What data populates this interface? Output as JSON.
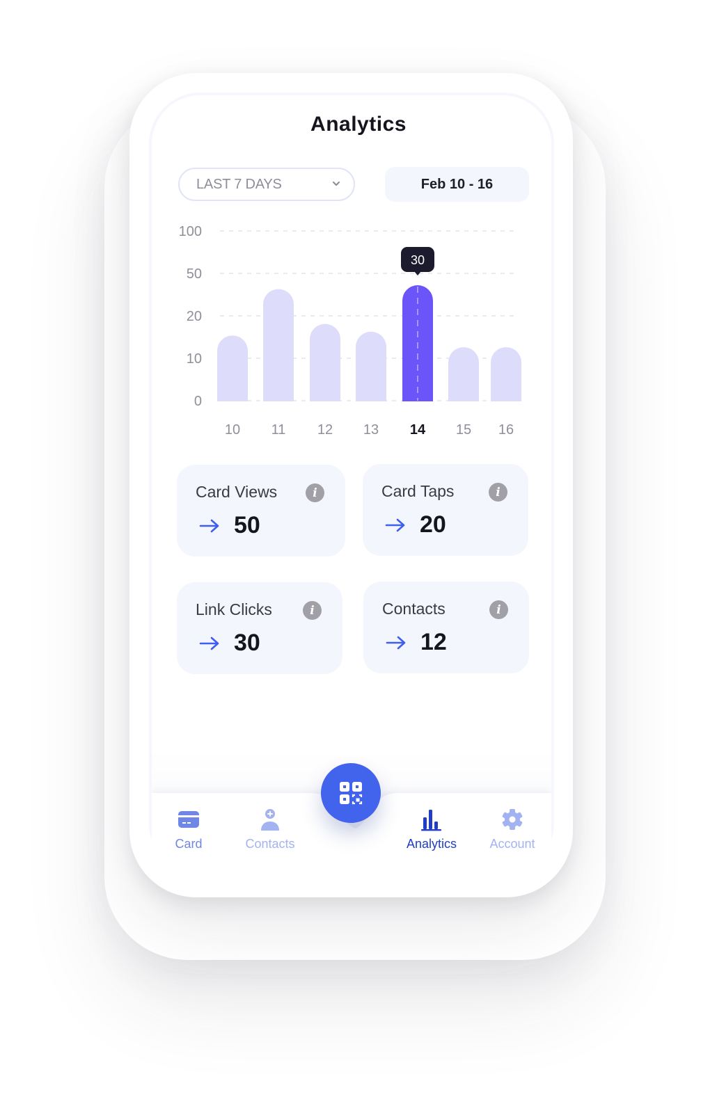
{
  "header": {
    "title": "Analytics"
  },
  "filters": {
    "range_selected": "LAST 7 DAYS",
    "date_range": "Feb 10 - 16"
  },
  "colors": {
    "bar": "#dedcfb",
    "bar_active": "#6c55f8",
    "accent": "#4263eb",
    "nav_active": "#1f3dc7",
    "nav_inactive": "#9fb0ef",
    "nav_card": "#6f86e6"
  },
  "chart_data": {
    "type": "bar",
    "title": "",
    "xlabel": "",
    "ylabel": "",
    "categories": [
      "10",
      "11",
      "12",
      "13",
      "14",
      "15",
      "16"
    ],
    "values": [
      17,
      29,
      20,
      18,
      30,
      14,
      14
    ],
    "highlighted_index": 4,
    "tooltip": "30",
    "y_ticks": [
      "100",
      "50",
      "20",
      "10",
      "0"
    ],
    "ylim": [
      0,
      100
    ],
    "grid": true,
    "legend": "none"
  },
  "stats": [
    {
      "label": "Card Views",
      "value": "50",
      "info_icon": "info-icon",
      "trend_icon": "arrow-right-icon"
    },
    {
      "label": "Card Taps",
      "value": "20",
      "info_icon": "info-icon",
      "trend_icon": "arrow-right-icon"
    },
    {
      "label": "Link Clicks",
      "value": "30",
      "info_icon": "info-icon",
      "trend_icon": "arrow-right-icon"
    },
    {
      "label": "Contacts",
      "value": "12",
      "info_icon": "info-icon",
      "trend_icon": "arrow-right-icon"
    }
  ],
  "nav": {
    "items": [
      {
        "label": "Card",
        "icon": "credit-card-icon",
        "active": false
      },
      {
        "label": "Contacts",
        "icon": "add-contact-icon",
        "active": false
      },
      {
        "label": "Analytics",
        "icon": "bar-chart-icon",
        "active": true
      },
      {
        "label": "Account",
        "icon": "gear-icon",
        "active": false
      }
    ],
    "fab_icon": "qr-code-icon"
  }
}
